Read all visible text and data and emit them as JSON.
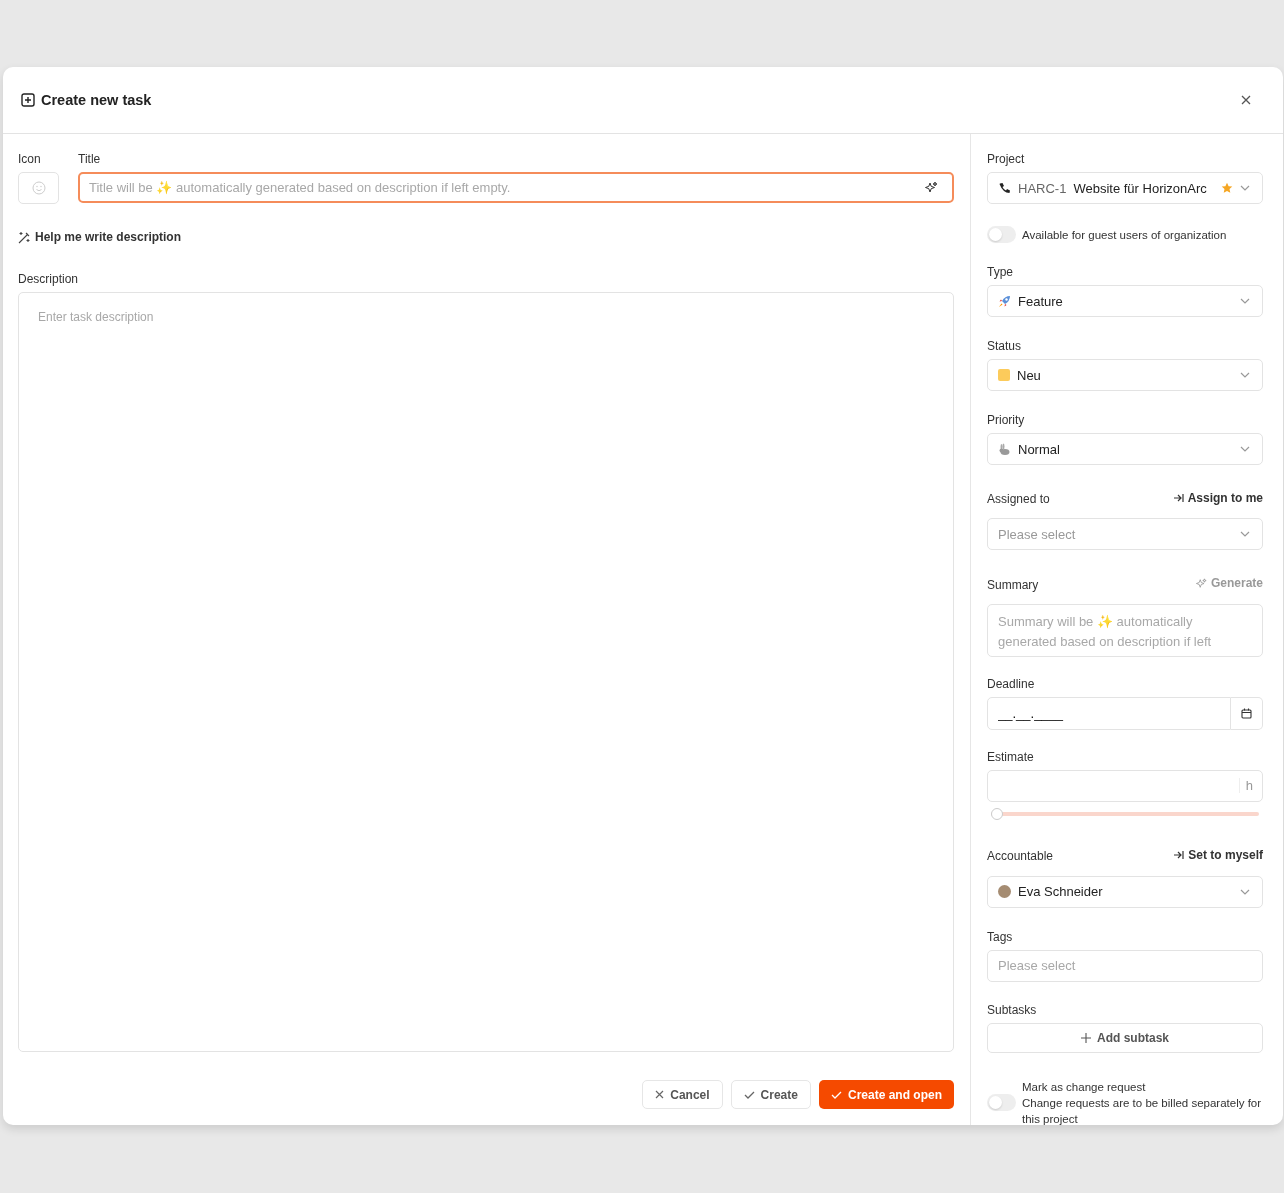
{
  "dialog": {
    "title": "Create new task"
  },
  "icon_field": {
    "label": "Icon"
  },
  "title_field": {
    "label": "Title",
    "placeholder": "Title will be ✨ automatically generated based on description if left empty.",
    "focused": true
  },
  "help_link": "Help me write description",
  "description": {
    "label": "Description",
    "placeholder": "Enter task description"
  },
  "buttons": [
    {
      "label": "Cancel",
      "kind": "cancel"
    },
    {
      "label": "Create",
      "kind": "create"
    },
    {
      "label": "Create and open",
      "kind": "primary"
    }
  ],
  "sidebar": {
    "project": {
      "label": "Project",
      "code": "HARC-1",
      "name": "Website für HorizonArc",
      "starred": true
    },
    "guest_toggle": {
      "label": "Available for guest users of organization",
      "on": false
    },
    "type": {
      "label": "Type",
      "value": "Feature"
    },
    "status": {
      "label": "Status",
      "value": "Neu",
      "color": "#fccb5b"
    },
    "priority": {
      "label": "Priority",
      "value": "Normal"
    },
    "assigned": {
      "label": "Assigned to",
      "action": "Assign to me",
      "placeholder": "Please select"
    },
    "summary": {
      "label": "Summary",
      "action": "Generate",
      "placeholder": "Summary will be ✨ automatically generated based on description if left"
    },
    "deadline": {
      "label": "Deadline",
      "value": "__.__.____"
    },
    "estimate": {
      "label": "Estimate",
      "unit": "h",
      "level": 0
    },
    "accountable": {
      "label": "Accountable",
      "action": "Set to myself",
      "value": "Eva Schneider"
    },
    "tags": {
      "label": "Tags",
      "placeholder": "Please select"
    },
    "subtasks": {
      "label": "Subtasks",
      "button": "Add subtask"
    },
    "change_request": {
      "label": "Mark as change request",
      "description": "Change requests are to be billed separately for this project",
      "on": false
    }
  }
}
